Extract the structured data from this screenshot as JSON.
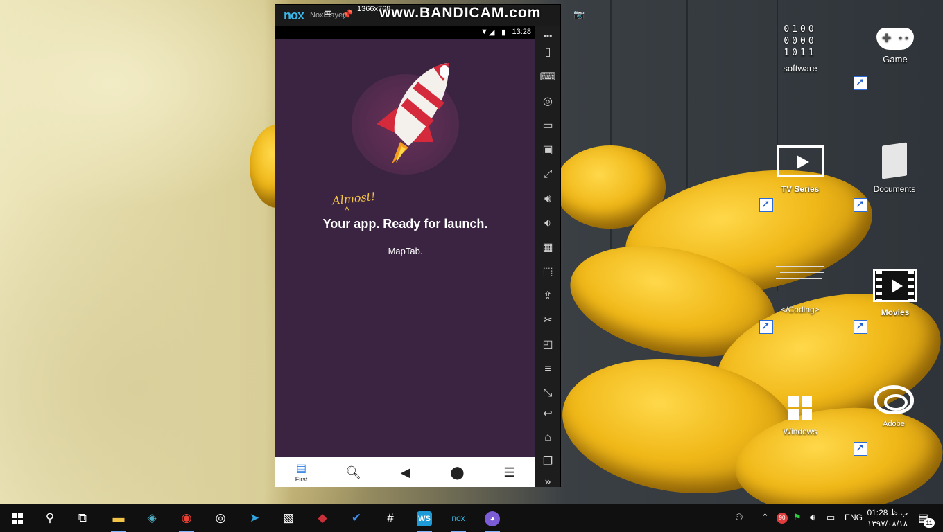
{
  "desktop": {
    "icons": {
      "software": {
        "label": "software",
        "binary": [
          "0100",
          "0000",
          "1011"
        ]
      },
      "game": {
        "label": "Game"
      },
      "tv_series": {
        "label": "TV Series"
      },
      "documents": {
        "label": "Documents"
      },
      "coding": {
        "label": "</Coding>"
      },
      "movies": {
        "label": "Movies"
      },
      "windows": {
        "label": "Windows"
      },
      "adobe": {
        "label": "Adobe"
      }
    }
  },
  "emulator": {
    "logo": "nox",
    "title": "NoxPlayer",
    "recording_size": "1366x768",
    "watermark": "www.BANDICAM.com",
    "statusbar": {
      "clock": "13:28"
    },
    "app": {
      "almost": "Almost!",
      "caret": "^",
      "headline": "Your app. Ready for launch.",
      "subtitle": "MapTab."
    },
    "bottom_nav": [
      {
        "icon": "chat-icon",
        "label": "First",
        "active": true
      },
      {
        "icon": "search-icon"
      },
      {
        "icon": "speaker-icon"
      },
      {
        "icon": "map-pin-icon"
      },
      {
        "icon": "menu-icon"
      }
    ]
  },
  "taskbar": {
    "language": "ENG",
    "time": "01:28 ب.ظ",
    "date": "۱۳۹۷/۰۸/۱۸",
    "notification_count": "11",
    "tray_badge": "90"
  },
  "colors": {
    "app_background": "#3b2342",
    "accent_yellow": "#f2c447",
    "nav_active": "#2a7de1",
    "taskbar": "#101010"
  }
}
